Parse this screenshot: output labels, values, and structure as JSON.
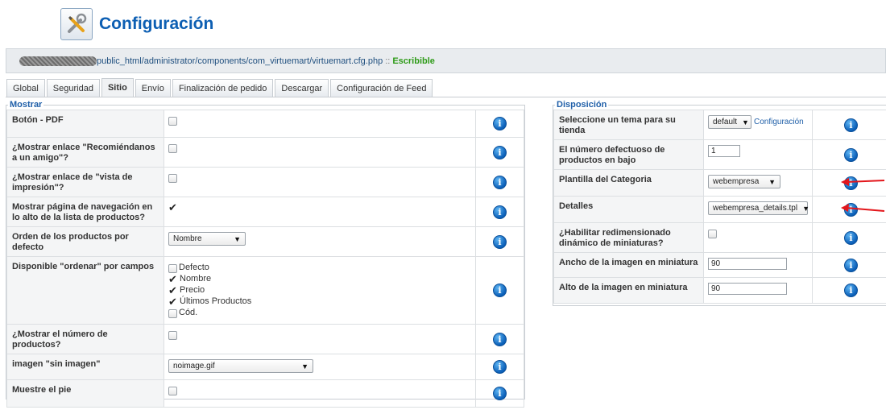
{
  "header": {
    "title": "Configuración",
    "icon": "tools-icon"
  },
  "path": {
    "text": "public_html/administrator/components/com_virtuemart/virtuemart.cfg.php",
    "separator": "::",
    "status": "Escribible",
    "status_color": "#2e9b18"
  },
  "tabs": [
    "Global",
    "Seguridad",
    "Sitio",
    "Envío",
    "Finalización de pedido",
    "Descargar",
    "Configuración de Feed"
  ],
  "active_tab": "Sitio",
  "mostrar": {
    "legend": "Mostrar",
    "rows": {
      "pdf": {
        "label": "Botón - PDF",
        "checked": false
      },
      "recomiendanos": {
        "label": "¿Mostrar enlace \"Recomiéndanos a un amigo\"?",
        "checked": false
      },
      "vista_impresion": {
        "label": "¿Mostrar enlace de \"vista de impresión\"?",
        "checked": false
      },
      "navegacion": {
        "label": "Mostrar página de navegación en lo alto de la lista de productos?",
        "checked": true
      },
      "orden": {
        "label": "Orden de los productos por defecto",
        "value": "Nombre"
      },
      "ordenar_campos": {
        "label": "Disponible \"ordenar\" por campos",
        "options": [
          {
            "label": "Defecto",
            "checked": false
          },
          {
            "label": "Nombre",
            "checked": true
          },
          {
            "label": "Precio",
            "checked": true
          },
          {
            "label": "Últimos Productos",
            "checked": true
          },
          {
            "label": "Cód.",
            "checked": false
          }
        ]
      },
      "numero_productos": {
        "label": "¿Mostrar el número de productos?",
        "checked": false
      },
      "sin_imagen": {
        "label": "imagen \"sin imagen\"",
        "value": "noimage.gif"
      },
      "pie": {
        "label": "Muestre el pie",
        "checked": false
      }
    }
  },
  "disposicion": {
    "legend": "Disposición",
    "rows": {
      "tema": {
        "label": "Seleccione un tema para su tienda",
        "value": "default",
        "link": "Configuración"
      },
      "num_productos": {
        "label": "El número defectuoso de productos en bajo",
        "value": "1"
      },
      "plantilla_categoria": {
        "label": "Plantilla del Categoria",
        "value": "webempresa"
      },
      "detalles": {
        "label": "Detalles",
        "value": "webempresa_details.tpl"
      },
      "redimensionado": {
        "label": "¿Habilitar redimensionado dinámico de miniaturas?",
        "checked": false
      },
      "ancho": {
        "label": "Ancho de la imagen en miniatura",
        "value": "90"
      },
      "alto": {
        "label": "Alto de la imagen en miniatura",
        "value": "90"
      }
    }
  },
  "colors": {
    "accent": "#0d5fb3",
    "annotation_arrow": "#e3161b"
  },
  "icons": {
    "info": "info-icon",
    "checkmark": "checkmark-icon",
    "dropdown": "dropdown-arrow-icon"
  }
}
